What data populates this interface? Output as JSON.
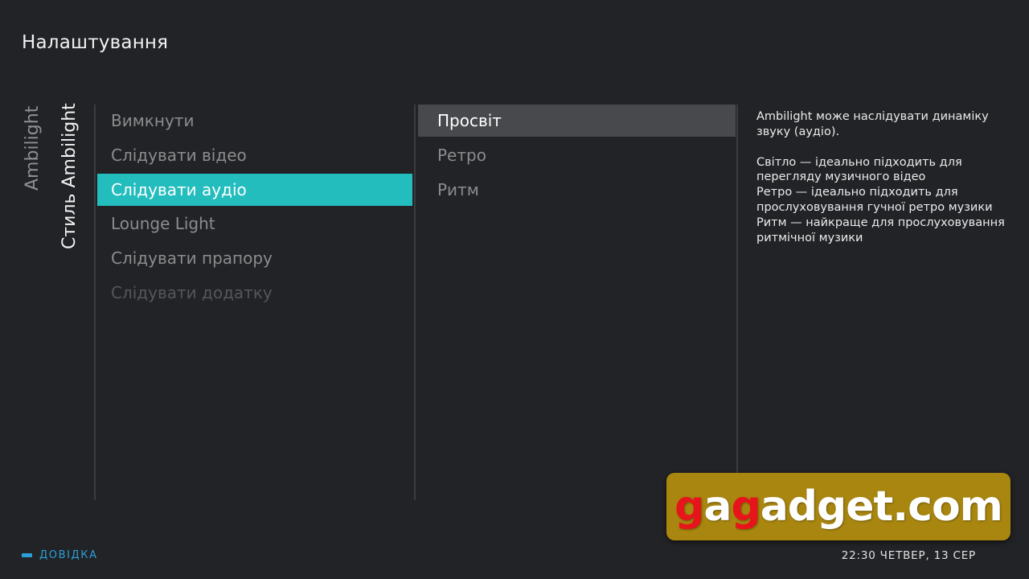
{
  "header": {
    "title": "Налаштування"
  },
  "breadcrumb": {
    "parent": "Ambilight",
    "current": "Стиль Ambilight"
  },
  "menu1": {
    "items": [
      {
        "label": "Вимкнути",
        "state": "normal"
      },
      {
        "label": "Слідувати відео",
        "state": "normal"
      },
      {
        "label": "Слідувати аудіо",
        "state": "selected"
      },
      {
        "label": "Lounge Light",
        "state": "normal"
      },
      {
        "label": "Слідувати прапору",
        "state": "normal"
      },
      {
        "label": "Слідувати додатку",
        "state": "disabled"
      }
    ]
  },
  "menu2": {
    "items": [
      {
        "label": "Просвіт",
        "state": "focused"
      },
      {
        "label": "Ретро",
        "state": "normal"
      },
      {
        "label": "Ритм",
        "state": "normal"
      }
    ]
  },
  "description": {
    "intro": "Ambilight може наслідувати динаміку звуку (аудіо).",
    "lines": [
      "Світло — ідеально підходить для перегляду музичного відео",
      "Ретро — ідеально підходить для прослуховування гучної ретро музики",
      "Ритм — найкраще для прослуховування ритмічної музики"
    ]
  },
  "footer": {
    "help_label": "ДОВІДКА",
    "clock": "22:30 ЧЕТВЕР, 13 СЕР"
  },
  "watermark": {
    "part1": "g",
    "part2": "a",
    "part3": "g",
    "part4": "adget.com"
  },
  "colors": {
    "background": "#222326",
    "selected": "#23bdbd",
    "focused": "#48494d",
    "help_accent": "#2a9fd8",
    "logo_bg": "#a8860f",
    "logo_red": "#e8141b"
  },
  "icons": {
    "help_key": "blue-key-icon"
  }
}
